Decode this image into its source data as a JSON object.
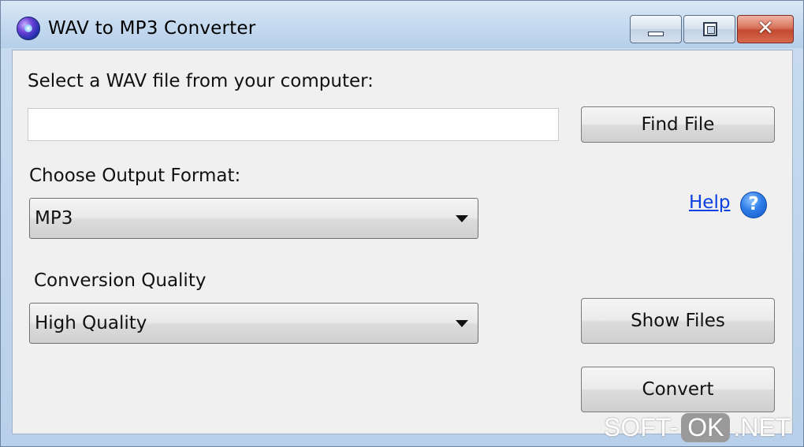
{
  "window": {
    "title": "WAV to MP3 Converter",
    "icon": "app-globe-icon"
  },
  "titlebar_buttons": {
    "minimize_icon": "minimize-icon",
    "maximize_icon": "maximize-icon",
    "close_glyph": "✕"
  },
  "file_section": {
    "label": "Select a WAV file from your computer:",
    "path_value": "",
    "path_placeholder": "",
    "find_button": "Find File"
  },
  "format_section": {
    "label": "Choose Output Format:",
    "selected": "MP3"
  },
  "quality_section": {
    "label": "Conversion Quality",
    "selected": "High Quality"
  },
  "help": {
    "link_text": "Help",
    "icon_glyph": "?"
  },
  "actions": {
    "show_files": "Show Files",
    "convert": "Convert"
  },
  "watermark": {
    "part1": "SOFT-",
    "part2": "OK",
    "part3": ".NET"
  },
  "colors": {
    "link": "#0a3fe0",
    "close_button": "#c24a30",
    "client_bg": "#f0f0f0"
  }
}
